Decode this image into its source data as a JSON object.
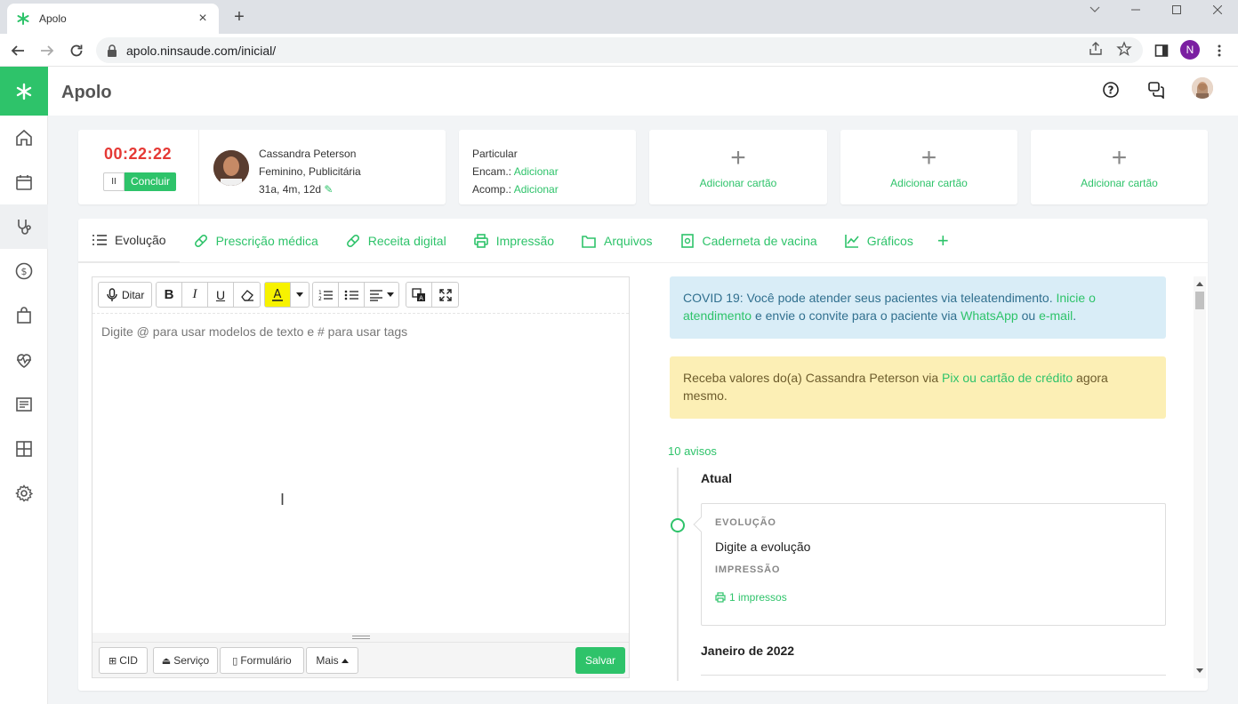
{
  "browser": {
    "tab_title": "Apolo",
    "url": "apolo.ninsaude.com/inicial/",
    "profile_initial": "N"
  },
  "app": {
    "brand": "Apolo",
    "accent": "#2ec36a"
  },
  "timer": {
    "time": "00:22:22",
    "pause_label": "II",
    "conclude_label": "Concluir"
  },
  "patient": {
    "name": "Cassandra Peterson",
    "details": "Feminino, Publicitária",
    "age": "31a, 4m, 12d"
  },
  "insurance": {
    "type": "Particular",
    "encam_label": "Encam.:",
    "encam_link": "Adicionar",
    "acomp_label": "Acomp.:",
    "acomp_link": "Adicionar"
  },
  "add_cards": [
    {
      "label": "Adicionar cartão"
    },
    {
      "label": "Adicionar cartão"
    },
    {
      "label": "Adicionar cartão"
    }
  ],
  "tabs": [
    {
      "label": "Evolução",
      "icon": "list-icon"
    },
    {
      "label": "Prescrição médica",
      "icon": "pill-icon"
    },
    {
      "label": "Receita digital",
      "icon": "pill-icon"
    },
    {
      "label": "Impressão",
      "icon": "printer-icon"
    },
    {
      "label": "Arquivos",
      "icon": "folder-icon"
    },
    {
      "label": "Caderneta de vacina",
      "icon": "vaccine-book-icon"
    },
    {
      "label": "Gráficos",
      "icon": "chart-icon"
    }
  ],
  "editor": {
    "dictate_label": "Ditar",
    "placeholder": "Digite @ para usar modelos de texto e # para usar tags",
    "footer": {
      "cid": "CID",
      "service": "Serviço",
      "form": "Formulário",
      "more": "Mais",
      "save": "Salvar"
    }
  },
  "alerts": {
    "covid": {
      "pre": "COVID 19: Você pode atender seus pacientes via teleatendimento. ",
      "link1": "Inicie o atendimento",
      "mid": " e envie o convite para o paciente via ",
      "link2": "WhatsApp",
      "mid2": " ou ",
      "link3": "e-mail",
      "post": "."
    },
    "payment": {
      "pre": "Receba valores do(a) Cassandra Peterson via ",
      "link": "Pix ou cartão de crédito",
      "post": " agora mesmo."
    }
  },
  "timeline": {
    "count": "10 avisos",
    "current_header": "Atual",
    "evolution_label": "EVOLUÇÃO",
    "evolution_text": "Digite a evolução",
    "print_label": "IMPRESSÃO",
    "print_link": "1 impressos",
    "next_header": "Janeiro de 2022"
  }
}
